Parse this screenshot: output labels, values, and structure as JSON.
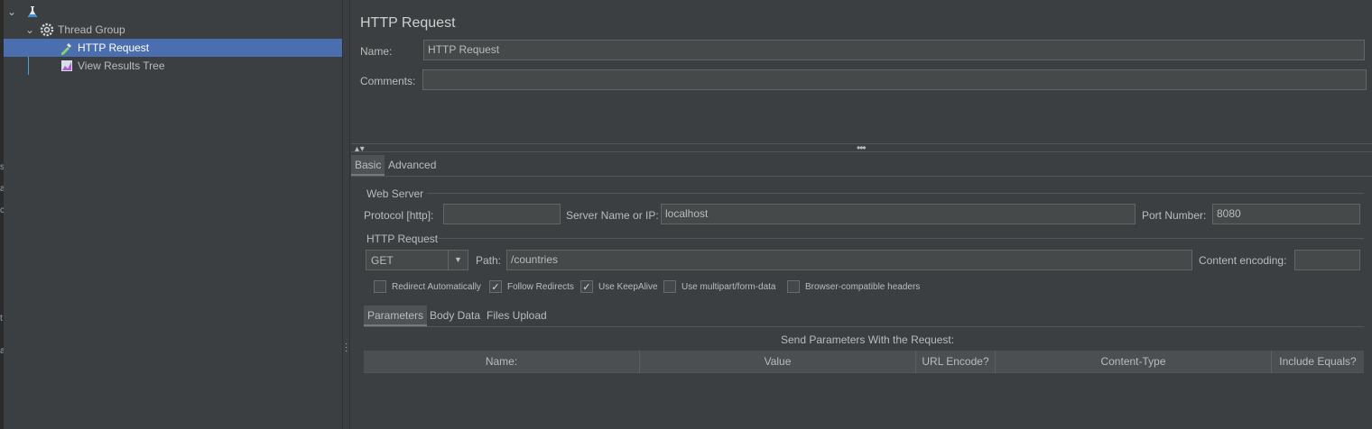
{
  "tree": {
    "items": [
      {
        "label": "",
        "icon": "flask-icon"
      },
      {
        "label": "Thread Group",
        "icon": "gear-icon"
      },
      {
        "label": "HTTP Request",
        "icon": "pipette-icon"
      },
      {
        "label": "View Results Tree",
        "icon": "chart-icon"
      }
    ]
  },
  "left_edge_glyphs": [
    "s",
    "a",
    "c",
    "t",
    "a"
  ],
  "main": {
    "title": "HTTP Request",
    "name_label": "Name:",
    "name_value": "HTTP Request",
    "comments_label": "Comments:",
    "comments_value": ""
  },
  "tabs": {
    "basic": "Basic",
    "advanced": "Advanced"
  },
  "web_server": {
    "group_title": "Web Server",
    "protocol_label": "Protocol [http]:",
    "protocol_value": "",
    "server_label": "Server Name or IP:",
    "server_value": "localhost",
    "port_label": "Port Number:",
    "port_value": "8080"
  },
  "http_request": {
    "group_title": "HTTP Request",
    "method": "GET",
    "path_label": "Path:",
    "path_value": "/countries",
    "encoding_label": "Content encoding:",
    "encoding_value": ""
  },
  "checkboxes": [
    {
      "label": "Redirect Automatically",
      "checked": false
    },
    {
      "label": "Follow Redirects",
      "checked": true
    },
    {
      "label": "Use KeepAlive",
      "checked": true
    },
    {
      "label": "Use multipart/form-data",
      "checked": false
    },
    {
      "label": "Browser-compatible headers",
      "checked": false
    }
  ],
  "subtabs": {
    "parameters": "Parameters",
    "body_data": "Body Data",
    "files_upload": "Files Upload"
  },
  "params": {
    "caption": "Send Parameters With the Request:",
    "columns": [
      "Name:",
      "Value",
      "URL Encode?",
      "Content-Type",
      "Include Equals?"
    ]
  },
  "colors": {
    "selected_row": "#4b6eaf",
    "background": "#3c3f41",
    "tree_line": "#4aa3df"
  }
}
